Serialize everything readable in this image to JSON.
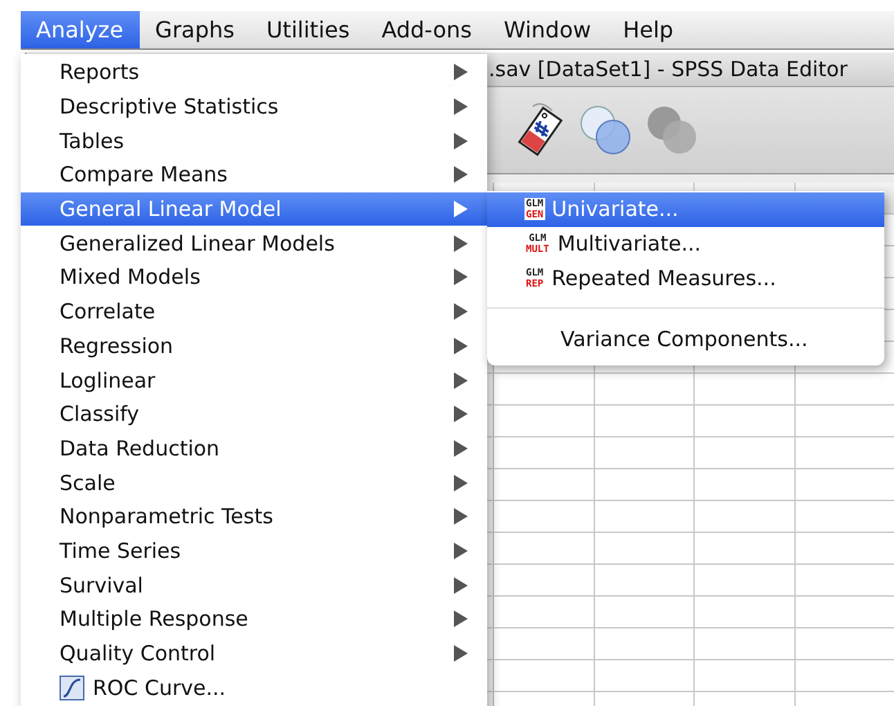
{
  "menubar": [
    {
      "label": "Analyze",
      "selected": true
    },
    {
      "label": "Graphs",
      "selected": false
    },
    {
      "label": "Utilities",
      "selected": false
    },
    {
      "label": "Add-ons",
      "selected": false
    },
    {
      "label": "Window",
      "selected": false
    },
    {
      "label": "Help",
      "selected": false
    }
  ],
  "window": {
    "title": ".sav [DataSet1] - SPSS Data Editor"
  },
  "menu": [
    {
      "label": "Reports",
      "kind": "submenu",
      "selected": false
    },
    {
      "label": "Descriptive Statistics",
      "kind": "submenu",
      "selected": false
    },
    {
      "label": "Tables",
      "kind": "submenu",
      "selected": false
    },
    {
      "label": "Compare Means",
      "kind": "submenu",
      "selected": false
    },
    {
      "label": "General Linear Model",
      "kind": "submenu",
      "selected": true
    },
    {
      "label": "Generalized Linear Models",
      "kind": "submenu",
      "selected": false
    },
    {
      "label": "Mixed Models",
      "kind": "submenu",
      "selected": false
    },
    {
      "label": "Correlate",
      "kind": "submenu",
      "selected": false
    },
    {
      "label": "Regression",
      "kind": "submenu",
      "selected": false
    },
    {
      "label": "Loglinear",
      "kind": "submenu",
      "selected": false
    },
    {
      "label": "Classify",
      "kind": "submenu",
      "selected": false
    },
    {
      "label": "Data Reduction",
      "kind": "submenu",
      "selected": false
    },
    {
      "label": "Scale",
      "kind": "submenu",
      "selected": false
    },
    {
      "label": "Nonparametric Tests",
      "kind": "submenu",
      "selected": false
    },
    {
      "label": "Time Series",
      "kind": "submenu",
      "selected": false
    },
    {
      "label": "Survival",
      "kind": "submenu",
      "selected": false
    },
    {
      "label": "Multiple Response",
      "kind": "submenu",
      "selected": false
    },
    {
      "label": "Quality Control",
      "kind": "submenu",
      "selected": false
    },
    {
      "label": "ROC Curve...",
      "kind": "curve",
      "selected": false
    }
  ],
  "submenu": [
    {
      "label": "Univariate...",
      "kind": "glm",
      "badge": [
        "GLM",
        "GEN"
      ],
      "selected": true
    },
    {
      "label": "Multivariate...",
      "kind": "glm",
      "badge": [
        "GLM",
        "MULT"
      ],
      "selected": false
    },
    {
      "label": "Repeated Measures...",
      "kind": "glm",
      "badge": [
        "GLM",
        "REP"
      ],
      "selected": false
    },
    {
      "kind": "separator"
    },
    {
      "label": "Variance Components...",
      "kind": "plain",
      "selected": false
    }
  ]
}
